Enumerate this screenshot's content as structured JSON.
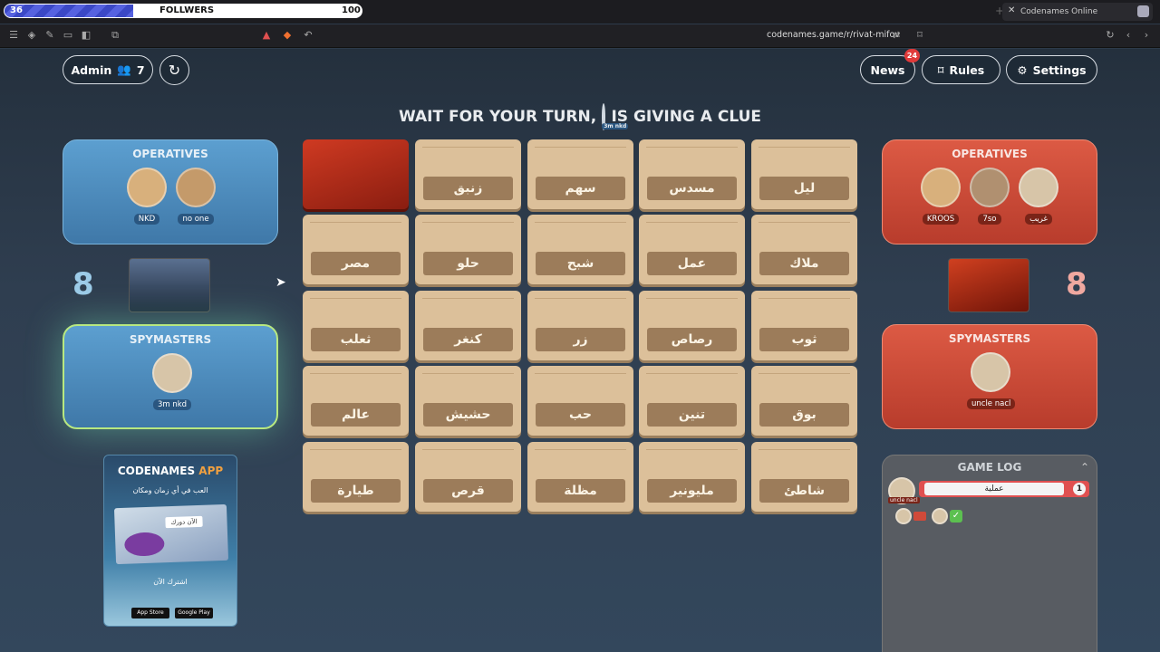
{
  "browser": {
    "followers": {
      "current": "36",
      "label": "FOLLWERS",
      "target": "100",
      "progress": 0.36
    },
    "tab_title": "Codenames Online",
    "url": "codenames.game/r/rivat-mifov"
  },
  "header": {
    "admin_label": "Admin",
    "player_count": "7",
    "news_label": "News",
    "news_badge": "24",
    "rules_label": "Rules",
    "settings_label": "Settings"
  },
  "status": {
    "left": "WAIT FOR YOUR TURN,",
    "right": "IS GIVING A CLUE",
    "avatar_caption": "3m nkd"
  },
  "blue_team": {
    "operatives_title": "OPERATIVES",
    "operatives": [
      "NKD",
      "no one"
    ],
    "spymasters_title": "SPYMASTERS",
    "spymasters": [
      "3m nkd"
    ],
    "score": "8"
  },
  "red_team": {
    "operatives_title": "OPERATIVES",
    "operatives": [
      "KROOS",
      "7so",
      "غريب"
    ],
    "spymasters_title": "SPYMASTERS",
    "spymasters": [
      "uncle nacl"
    ],
    "score": "8"
  },
  "board": {
    "rows": [
      [
        "",
        "زنبق",
        "سهم",
        "مسدس",
        "ليل"
      ],
      [
        "مصر",
        "حلو",
        "شبح",
        "عمل",
        "ملاك"
      ],
      [
        "ثعلب",
        "كنغر",
        "زر",
        "رصاص",
        "ثوب"
      ],
      [
        "عالم",
        "حشيش",
        "حب",
        "تنين",
        "بوق"
      ],
      [
        "طيارة",
        "قرص",
        "مظلة",
        "مليونير",
        "شاطئ"
      ]
    ]
  },
  "app_promo": {
    "title_main": "CODENAMES",
    "title_accent": "APP",
    "tagline": "العب في أي زمان ومكان",
    "inner_label": "الآن دورك",
    "cta": "اشترك الآن",
    "app_store": "App Store",
    "google_play": "Google Play"
  },
  "game_log": {
    "title": "GAME LOG",
    "entries": [
      {
        "player": "uncle nacl",
        "clue": "عملية",
        "number": "1"
      }
    ]
  },
  "colors": {
    "blue_panel": "#4f8ec2",
    "red_panel": "#cc4a36",
    "card": "#dcc09a",
    "card_label": "#9c7c5a",
    "accent_green": "#7ce07a"
  }
}
